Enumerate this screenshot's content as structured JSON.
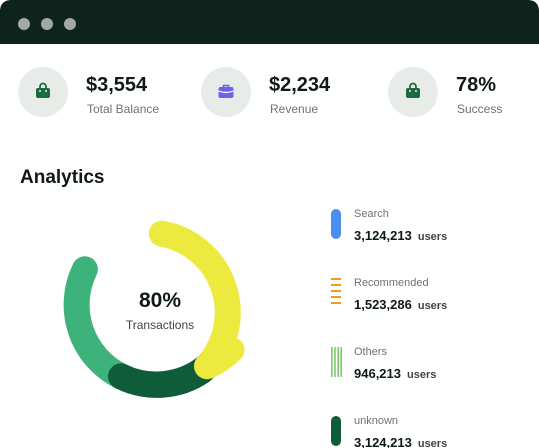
{
  "stats": [
    {
      "value": "$3,554",
      "label": "Total Balance",
      "icon": "shopping-bag-icon"
    },
    {
      "value": "$2,234",
      "label": "Revenue",
      "icon": "briefcase-icon"
    },
    {
      "value": "78%",
      "label": "Success",
      "icon": "shopping-bag-icon"
    }
  ],
  "analytics": {
    "title": "Analytics",
    "center_value": "80%",
    "center_label": "Transactions"
  },
  "legend": [
    {
      "name": "Search",
      "count": "3,124,213",
      "unit": "users",
      "color": "#4a8ef0",
      "style": "pill"
    },
    {
      "name": "Recommended",
      "count": "1,523,286",
      "unit": "users",
      "color": "#f39a21",
      "style": "dashes"
    },
    {
      "name": "Others",
      "count": "946,213",
      "unit": "users",
      "color": "#7bcc6b",
      "style": "stripes"
    },
    {
      "name": "unknown",
      "count": "3,124,213",
      "unit": "users",
      "color": "#0f5c3b",
      "style": "pill"
    }
  ],
  "colors": {
    "titlebar": "#0e231b",
    "donut_yellow": "#ecea3f",
    "donut_dark_green": "#0f5c3b",
    "donut_light_green": "#3db27a",
    "icon_green": "#1c6b3f",
    "icon_purple": "#6b63e6"
  }
}
